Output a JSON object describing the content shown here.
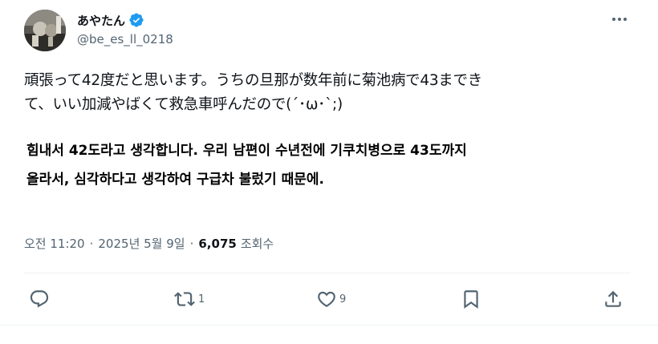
{
  "author": {
    "display_name": "あやたん",
    "handle": "@be_es_ll_0218",
    "verified": true,
    "verified_color": "#1d9bf0"
  },
  "tweet": {
    "text_line1": "頑張って42度だと思います。うちの旦那が数年前に菊池病で43までき",
    "text_line2": "て、いい加減やばくて救急車呼んだので(´･ω･`;)",
    "translation_line1": "힘내서 42도라고 생각합니다. 우리 남편이 수년전에 기쿠치병으로 43도까지",
    "translation_line2": "올라서, 심각하다고 생각하여 구급차 불렀기 때문에."
  },
  "meta": {
    "time": "오전 11:20",
    "separator1": "·",
    "date": "2025년 5월 9일",
    "separator2": "·",
    "views_count": "6,075",
    "views_label": "조회수"
  },
  "actions": {
    "reply_icon": "reply-icon",
    "retweet_icon": "retweet-icon",
    "retweet_count": "1",
    "like_icon": "heart-icon",
    "like_count": "9",
    "bookmark_icon": "bookmark-icon",
    "share_icon": "share-icon"
  },
  "colors": {
    "text_primary": "#0f1419",
    "text_secondary": "#536471",
    "divider": "#eff3f4"
  }
}
